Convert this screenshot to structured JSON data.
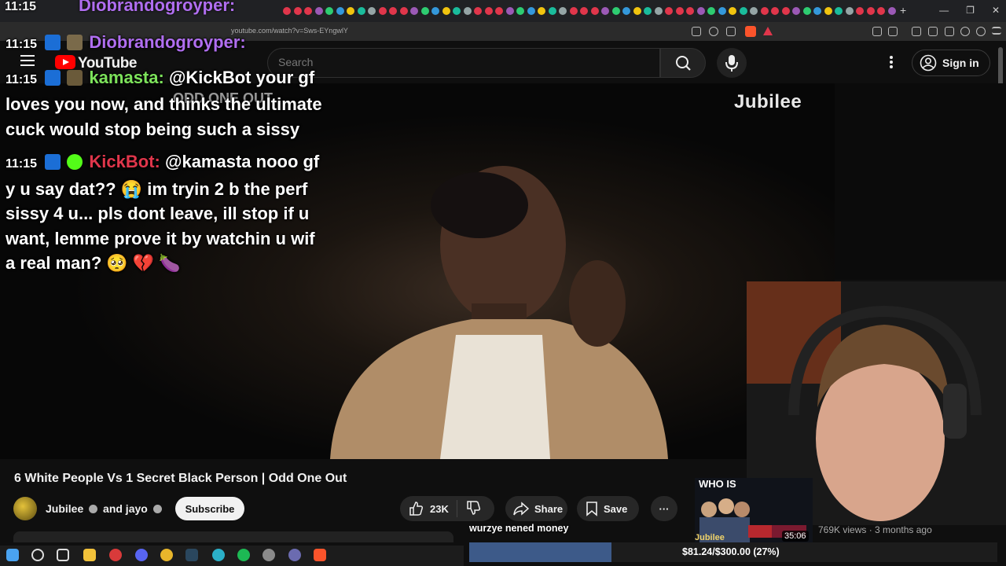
{
  "browser": {
    "url": "youtube.com/watch?v=Sws-EYngwlY",
    "new_tab_glyph": "+",
    "window_controls": [
      "—",
      "❐",
      "✕"
    ]
  },
  "youtube": {
    "logo_text": "YouTube",
    "search_placeholder": "Search",
    "sign_in_label": "Sign in",
    "watermark": "Jubilee",
    "video_overlay_text": "ODD ONE OUT"
  },
  "chat": {
    "messages": [
      {
        "time": "11:15",
        "user": "Diobrandogroyper:",
        "text": ""
      },
      {
        "time": "11:15",
        "user": "kamasta:",
        "text": "@KickBot your gf loves you now, and thinks the ultimate cuck would stop being such a sissy"
      },
      {
        "time": "11:15",
        "user": "KickBot:",
        "text": "@kamasta nooo gf y u say dat?? 😭 im tryin 2 b the perf sissy 4 u... pls dont leave, ill stop if u want, lemme prove it by watchin u wif a real man? 🥺 💔 🍆"
      }
    ],
    "top_clock": "11:15",
    "top_user": "Diobrandogroyper:"
  },
  "video": {
    "title": "6 White People Vs 1 Secret Black Person | Odd One Out",
    "channel": "Jubilee",
    "collab_text": "and jayo",
    "subscribe_label": "Subscribe",
    "likes": "23K",
    "share_label": "Share",
    "save_label": "Save",
    "more_label": "···"
  },
  "related": {
    "title": "WHO IS",
    "channel_tag": "Jubilee",
    "duration": "35:06",
    "meta": "769K views · 3 months ago"
  },
  "donation": {
    "label": "wurzye nened money",
    "amount_text": "$81.24/$300.00 (27%)",
    "progress": 0.27
  },
  "colors": {
    "accent_red": "#ff0000",
    "kick_green": "#53fc18",
    "donation_fill": "#3d5a89"
  }
}
